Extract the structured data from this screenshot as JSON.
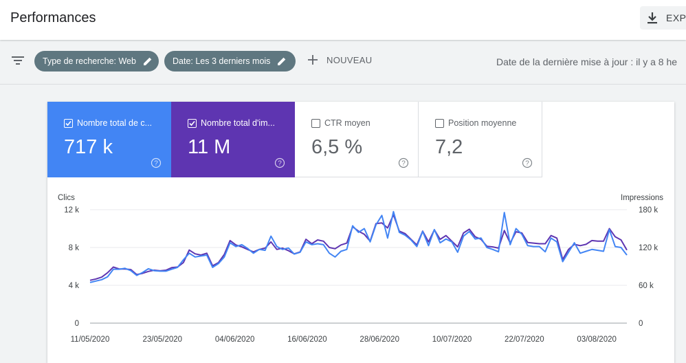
{
  "header": {
    "title": "Performances",
    "export_label": "EXP"
  },
  "filters": {
    "chips": [
      {
        "label": "Type de recherche: Web"
      },
      {
        "label": "Date: Les 3 derniers mois"
      }
    ],
    "new_label": "NOUVEAU",
    "update_text": "Date de la dernière mise à jour : il y a 8 he"
  },
  "metrics": [
    {
      "label": "Nombre total de c...",
      "value": "717 k",
      "checked": true,
      "color": "#4285f4"
    },
    {
      "label": "Nombre total d'im...",
      "value": "11 M",
      "checked": true,
      "color": "#5e35b1"
    },
    {
      "label": "CTR moyen",
      "value": "6,5 %",
      "checked": false
    },
    {
      "label": "Position moyenne",
      "value": "7,2",
      "checked": false
    }
  ],
  "chart_data": {
    "type": "line",
    "left_axis_label": "Clics",
    "right_axis_label": "Impressions",
    "left_ticks": [
      "12 k",
      "8 k",
      "4 k",
      "0"
    ],
    "right_ticks": [
      "180 k",
      "120 k",
      "60 k",
      "0"
    ],
    "ylim_left": [
      0,
      12000
    ],
    "ylim_right": [
      0,
      180000
    ],
    "x_ticks": [
      "11/05/2020",
      "23/05/2020",
      "04/06/2020",
      "16/06/2020",
      "28/06/2020",
      "10/07/2020",
      "22/07/2020",
      "03/08/2020"
    ],
    "x_start": "11/05/2020",
    "x_end": "08/08/2020",
    "series": [
      {
        "name": "Nombre total de clics",
        "axis": "left",
        "color": "#4285f4",
        "values": [
          4300,
          4450,
          4600,
          4900,
          5700,
          5700,
          5800,
          5550,
          5050,
          5350,
          5750,
          5550,
          5500,
          5500,
          5700,
          5900,
          6700,
          7400,
          7000,
          7100,
          7200,
          5900,
          6300,
          7000,
          8500,
          8100,
          8300,
          7900,
          7400,
          7800,
          7700,
          9200,
          8100,
          7800,
          7950,
          7300,
          7500,
          8600,
          8300,
          8400,
          8300,
          7400,
          7000,
          7600,
          7800,
          10300,
          9600,
          10000,
          8600,
          10400,
          11400,
          9000,
          11800,
          9600,
          9300,
          8800,
          8100,
          9700,
          8200,
          9900,
          8500,
          8900,
          8600,
          7500,
          9200,
          9700,
          8900,
          9000,
          8000,
          7800,
          7550,
          11700,
          8300,
          10000,
          9400,
          8200,
          8100,
          8100,
          7550,
          9000,
          8600,
          6500,
          7500,
          8500,
          7400,
          7600,
          7800,
          7700,
          7600,
          9900,
          8100,
          8000,
          7200
        ]
      },
      {
        "name": "Nombre total d'impressions",
        "axis": "right",
        "color": "#5e35b1",
        "values": [
          68000,
          70000,
          73000,
          80000,
          89000,
          86000,
          86000,
          85000,
          77000,
          79000,
          82000,
          84000,
          83000,
          84000,
          88000,
          89000,
          96000,
          116000,
          110000,
          108000,
          111000,
          91000,
          96000,
          109000,
          131000,
          124000,
          121000,
          117000,
          113000,
          117000,
          119000,
          129000,
          117000,
          119000,
          115000,
          110000,
          113000,
          133000,
          126000,
          132000,
          130000,
          120000,
          118000,
          124000,
          127000,
          153000,
          146000,
          141000,
          130000,
          158000,
          159000,
          151000,
          172000,
          146000,
          142000,
          133000,
          124000,
          146000,
          129000,
          148000,
          133000,
          139000,
          130000,
          121000,
          143000,
          149000,
          137000,
          133000,
          122000,
          121000,
          119000,
          147000,
          127000,
          145000,
          143000,
          128000,
          127000,
          126000,
          126000,
          139000,
          135000,
          101000,
          117000,
          125000,
          123000,
          125000,
          131000,
          130000,
          130000,
          150000,
          137000,
          132000,
          116000
        ]
      }
    ]
  }
}
